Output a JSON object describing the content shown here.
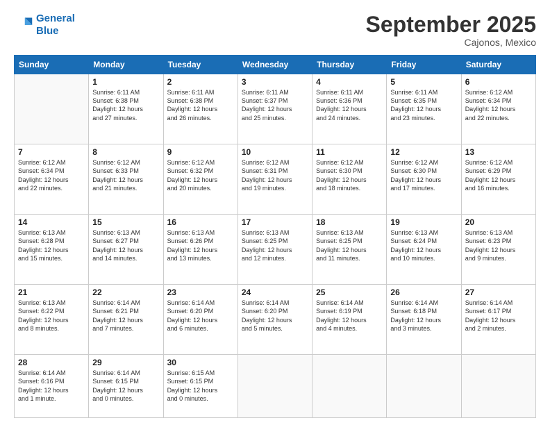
{
  "header": {
    "logo_line1": "General",
    "logo_line2": "Blue",
    "month": "September 2025",
    "location": "Cajonos, Mexico"
  },
  "weekdays": [
    "Sunday",
    "Monday",
    "Tuesday",
    "Wednesday",
    "Thursday",
    "Friday",
    "Saturday"
  ],
  "weeks": [
    [
      {
        "day": "",
        "info": ""
      },
      {
        "day": "1",
        "info": "Sunrise: 6:11 AM\nSunset: 6:38 PM\nDaylight: 12 hours\nand 27 minutes."
      },
      {
        "day": "2",
        "info": "Sunrise: 6:11 AM\nSunset: 6:38 PM\nDaylight: 12 hours\nand 26 minutes."
      },
      {
        "day": "3",
        "info": "Sunrise: 6:11 AM\nSunset: 6:37 PM\nDaylight: 12 hours\nand 25 minutes."
      },
      {
        "day": "4",
        "info": "Sunrise: 6:11 AM\nSunset: 6:36 PM\nDaylight: 12 hours\nand 24 minutes."
      },
      {
        "day": "5",
        "info": "Sunrise: 6:11 AM\nSunset: 6:35 PM\nDaylight: 12 hours\nand 23 minutes."
      },
      {
        "day": "6",
        "info": "Sunrise: 6:12 AM\nSunset: 6:34 PM\nDaylight: 12 hours\nand 22 minutes."
      }
    ],
    [
      {
        "day": "7",
        "info": "Sunrise: 6:12 AM\nSunset: 6:34 PM\nDaylight: 12 hours\nand 22 minutes."
      },
      {
        "day": "8",
        "info": "Sunrise: 6:12 AM\nSunset: 6:33 PM\nDaylight: 12 hours\nand 21 minutes."
      },
      {
        "day": "9",
        "info": "Sunrise: 6:12 AM\nSunset: 6:32 PM\nDaylight: 12 hours\nand 20 minutes."
      },
      {
        "day": "10",
        "info": "Sunrise: 6:12 AM\nSunset: 6:31 PM\nDaylight: 12 hours\nand 19 minutes."
      },
      {
        "day": "11",
        "info": "Sunrise: 6:12 AM\nSunset: 6:30 PM\nDaylight: 12 hours\nand 18 minutes."
      },
      {
        "day": "12",
        "info": "Sunrise: 6:12 AM\nSunset: 6:30 PM\nDaylight: 12 hours\nand 17 minutes."
      },
      {
        "day": "13",
        "info": "Sunrise: 6:12 AM\nSunset: 6:29 PM\nDaylight: 12 hours\nand 16 minutes."
      }
    ],
    [
      {
        "day": "14",
        "info": "Sunrise: 6:13 AM\nSunset: 6:28 PM\nDaylight: 12 hours\nand 15 minutes."
      },
      {
        "day": "15",
        "info": "Sunrise: 6:13 AM\nSunset: 6:27 PM\nDaylight: 12 hours\nand 14 minutes."
      },
      {
        "day": "16",
        "info": "Sunrise: 6:13 AM\nSunset: 6:26 PM\nDaylight: 12 hours\nand 13 minutes."
      },
      {
        "day": "17",
        "info": "Sunrise: 6:13 AM\nSunset: 6:25 PM\nDaylight: 12 hours\nand 12 minutes."
      },
      {
        "day": "18",
        "info": "Sunrise: 6:13 AM\nSunset: 6:25 PM\nDaylight: 12 hours\nand 11 minutes."
      },
      {
        "day": "19",
        "info": "Sunrise: 6:13 AM\nSunset: 6:24 PM\nDaylight: 12 hours\nand 10 minutes."
      },
      {
        "day": "20",
        "info": "Sunrise: 6:13 AM\nSunset: 6:23 PM\nDaylight: 12 hours\nand 9 minutes."
      }
    ],
    [
      {
        "day": "21",
        "info": "Sunrise: 6:13 AM\nSunset: 6:22 PM\nDaylight: 12 hours\nand 8 minutes."
      },
      {
        "day": "22",
        "info": "Sunrise: 6:14 AM\nSunset: 6:21 PM\nDaylight: 12 hours\nand 7 minutes."
      },
      {
        "day": "23",
        "info": "Sunrise: 6:14 AM\nSunset: 6:20 PM\nDaylight: 12 hours\nand 6 minutes."
      },
      {
        "day": "24",
        "info": "Sunrise: 6:14 AM\nSunset: 6:20 PM\nDaylight: 12 hours\nand 5 minutes."
      },
      {
        "day": "25",
        "info": "Sunrise: 6:14 AM\nSunset: 6:19 PM\nDaylight: 12 hours\nand 4 minutes."
      },
      {
        "day": "26",
        "info": "Sunrise: 6:14 AM\nSunset: 6:18 PM\nDaylight: 12 hours\nand 3 minutes."
      },
      {
        "day": "27",
        "info": "Sunrise: 6:14 AM\nSunset: 6:17 PM\nDaylight: 12 hours\nand 2 minutes."
      }
    ],
    [
      {
        "day": "28",
        "info": "Sunrise: 6:14 AM\nSunset: 6:16 PM\nDaylight: 12 hours\nand 1 minute."
      },
      {
        "day": "29",
        "info": "Sunrise: 6:14 AM\nSunset: 6:15 PM\nDaylight: 12 hours\nand 0 minutes."
      },
      {
        "day": "30",
        "info": "Sunrise: 6:15 AM\nSunset: 6:15 PM\nDaylight: 12 hours\nand 0 minutes."
      },
      {
        "day": "",
        "info": ""
      },
      {
        "day": "",
        "info": ""
      },
      {
        "day": "",
        "info": ""
      },
      {
        "day": "",
        "info": ""
      }
    ]
  ]
}
